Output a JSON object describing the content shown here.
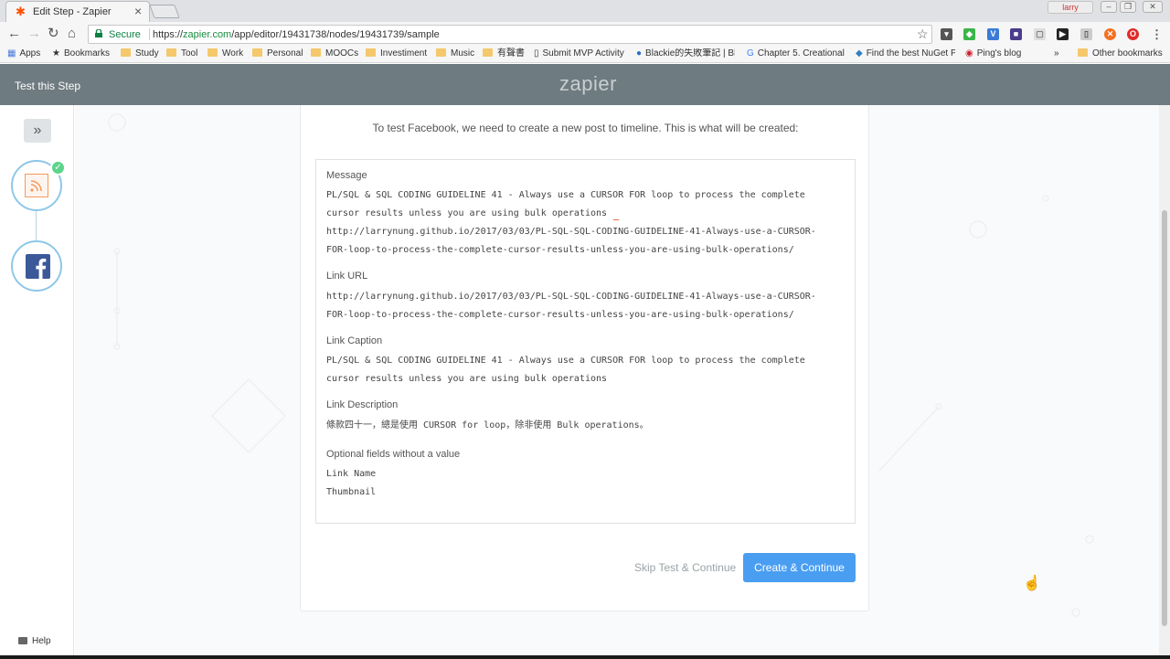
{
  "browser": {
    "tab_title": "Edit Step - Zapier",
    "tab_close": "×",
    "user_label": "larry",
    "secure_label": "Secure",
    "url_protocol": "https://",
    "url_host": "zapier.com",
    "url_path": "/app/editor/19431738/nodes/19431739/sample",
    "nav_back": "←",
    "nav_forward": "→",
    "nav_reload": "↻",
    "nav_home": "⌂",
    "star": "☆",
    "bookmarks": [
      "Apps",
      "Bookmarks",
      "Study",
      "Tool",
      "Work",
      "Personal",
      "MOOCs",
      "Investiment",
      "Music",
      "有聲書",
      "Submit MVP Activity",
      "Blackie的失敗筆記 | Bl",
      "Chapter 5. Creational",
      "Find the best NuGet P",
      "Ping's blog",
      "»",
      "Other bookmarks"
    ]
  },
  "header": {
    "left_title": "Test this Step",
    "logo": "zapier"
  },
  "sidebar": {
    "expand_icon": "»",
    "check": "✓",
    "help_label": "Help"
  },
  "content": {
    "intro": "To test Facebook, we need to create a new post to timeline. This is what will be created:",
    "fields": {
      "message_label": "Message",
      "message_value_line1": "PL/SQL & SQL CODING GUIDELINE 41 - Always use a CURSOR FOR loop to process the complete",
      "message_value_line2": "cursor results unless you are using bulk operations",
      "message_value_line3": "http://larrynung.github.io/2017/03/03/PL-SQL-SQL-CODING-GUIDELINE-41-Always-use-a-CURSOR-",
      "message_value_line4": "FOR-loop-to-process-the-complete-cursor-results-unless-you-are-using-bulk-operations/",
      "link_url_label": "Link URL",
      "link_url_line1": "http://larrynung.github.io/2017/03/03/PL-SQL-SQL-CODING-GUIDELINE-41-Always-use-a-CURSOR-",
      "link_url_line2": "FOR-loop-to-process-the-complete-cursor-results-unless-you-are-using-bulk-operations/",
      "link_caption_label": "Link Caption",
      "link_caption_line1": "PL/SQL & SQL CODING GUIDELINE 41 - Always use a CURSOR FOR loop to process the complete",
      "link_caption_line2": "cursor results unless you are using bulk operations",
      "link_description_label": "Link Description",
      "link_description_value": "條款四十一，總是使用 CURSOR for loop，除非使用 Bulk operations。",
      "optional_label": "Optional fields without a value",
      "optional_field1": "Link Name",
      "optional_field2": "Thumbnail"
    },
    "skip_label": "Skip Test & Continue",
    "create_label": "Create & Continue"
  },
  "colors": {
    "header_bg": "#6e7b80",
    "primary_button": "#4a9ef1",
    "check_green": "#5dd48b",
    "facebook": "#3b5998",
    "rss": "#f29a5b"
  }
}
